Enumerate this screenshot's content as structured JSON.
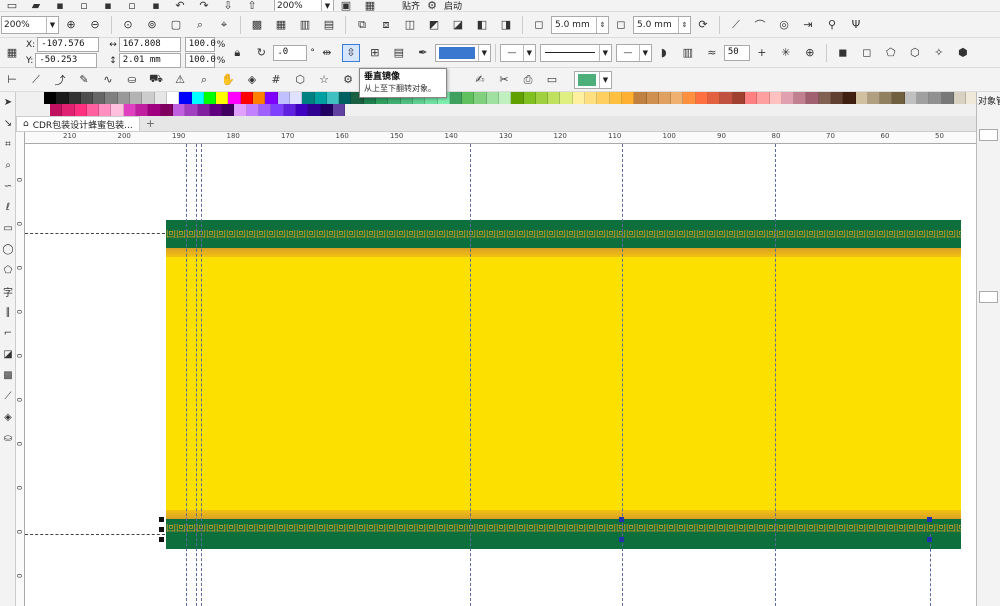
{
  "toolbar1": {
    "zoom_top": "200%",
    "snap_label": "贴齐",
    "launch_label": "启动"
  },
  "toolbar2": {
    "zoom": "200%",
    "outline_w1": "5.0 mm",
    "outline_w2": "5.0 mm"
  },
  "properties": {
    "x_label": "X:",
    "x": "-107.576 mm",
    "y_label": "Y:",
    "y": "-50.253 mm",
    "w": "167.808 mm",
    "h": "2.01 mm",
    "scale_x": "100.0",
    "scale_y": "100.0",
    "pct": "%",
    "rotation": ".0",
    "deg": "°",
    "transparency": "50"
  },
  "tooltip": {
    "title": "垂直镜像",
    "desc": "从上至下翻转对象。"
  },
  "document": {
    "tab_title": "CDR包装设计蜂蜜包装..."
  },
  "ruler": {
    "h_labels": [
      "210",
      "200",
      "190",
      "180",
      "170",
      "160",
      "150",
      "140",
      "130",
      "120",
      "110",
      "100",
      "90",
      "80",
      "70",
      "60",
      "50"
    ],
    "v_labels": [
      "0",
      "0",
      "0",
      "0",
      "0",
      "0",
      "0",
      "0",
      "0",
      "0"
    ]
  },
  "docker": {
    "title": "对象管"
  },
  "colors": {
    "banner_yellow": "#fbe000",
    "band_green": "#0d6f3c",
    "ornament_gold": "#d9a126",
    "guide_blue": "#5a6a9a",
    "fill_swatch": "#4caf7a"
  },
  "palette": {
    "row1": [
      "#000000",
      "#1a1a1a",
      "#333333",
      "#4d4d4d",
      "#666666",
      "#808080",
      "#999999",
      "#b3b3b3",
      "#cccccc",
      "#e6e6e6",
      "#ffffff",
      "#0000ff",
      "#00ffff",
      "#00ff00",
      "#ffff00",
      "#ff00ff",
      "#ff0000",
      "#ff8000",
      "#8000ff",
      "#c0c0ff",
      "#e0e0ff",
      "#008080",
      "#00a0a0",
      "#40c0c0",
      "#006060",
      "#1a6040",
      "#208050",
      "#30a060",
      "#40b070",
      "#50c080",
      "#60d090",
      "#70e0a0",
      "#80f0b0",
      "#40a060",
      "#60c060",
      "#80d080",
      "#a0e0a0",
      "#c0f0c0",
      "#60a000",
      "#80c020",
      "#a0d040",
      "#c0e060",
      "#e0f080",
      "#fff0a0",
      "#ffe080",
      "#ffd060",
      "#ffc040",
      "#ffb030",
      "#c08040",
      "#d09050",
      "#e0a060",
      "#f0b070",
      "#ff9040",
      "#ff7040",
      "#e06040",
      "#c05040",
      "#a04030",
      "#ff8080",
      "#ffa0a0",
      "#ffc0c0",
      "#e0a0b0",
      "#c08090",
      "#a06070",
      "#806050",
      "#604030",
      "#402010",
      "#d0c0a0",
      "#b0a080",
      "#908060",
      "#706040",
      "#c0c0c0",
      "#a0a0a0",
      "#909090",
      "#787878",
      "#d8d0c0",
      "#f0e8d8"
    ],
    "row2": [
      "#c01060",
      "#e02070",
      "#ff3080",
      "#ff60a0",
      "#ff90c0",
      "#ffc0e0",
      "#e040c0",
      "#c020a0",
      "#a00080",
      "#800060",
      "#c060e0",
      "#a040c0",
      "#8020a0",
      "#600080",
      "#400060",
      "#e0a0ff",
      "#c080ff",
      "#a060ff",
      "#8040ff",
      "#6020e0",
      "#4000c0",
      "#300090",
      "#200060",
      "#6040a0"
    ]
  },
  "tools_left": [
    "pick-icon",
    "shape-icon",
    "crop-icon",
    "zoom-icon",
    "freehand-icon",
    "artistic-icon",
    "rect-icon",
    "ellipse-icon",
    "polygon-icon",
    "text-icon",
    "parallel-icon",
    "connector-icon",
    "shadow-icon",
    "transparency-icon",
    "eyedropper-icon",
    "fill-icon",
    "smart-fill-icon"
  ]
}
